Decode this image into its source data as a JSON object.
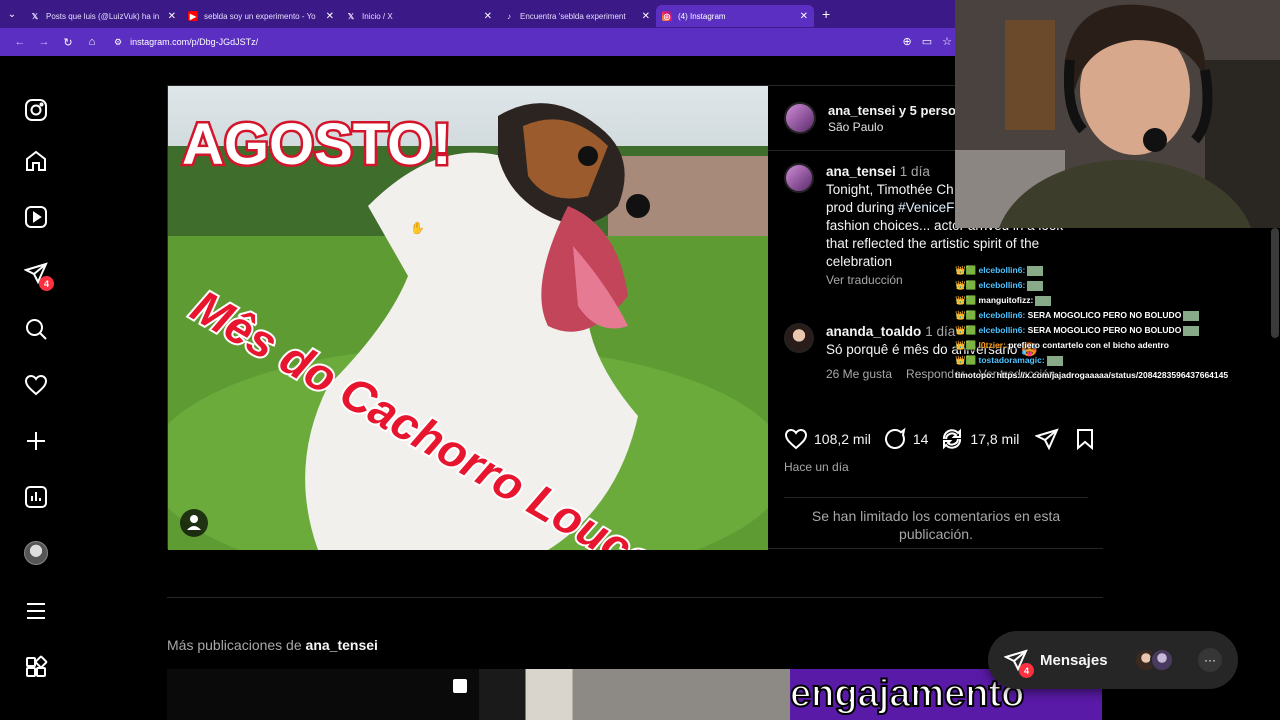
{
  "browser": {
    "tabs": [
      {
        "title": "Posts que luis (@LuizVuk) ha in",
        "icon": "x-logo"
      },
      {
        "title": "seblda soy un experimento - Yo",
        "icon": "youtube-logo"
      },
      {
        "title": "Inicio / X",
        "icon": "x-logo"
      },
      {
        "title": "Encuentra 'seblda experiment",
        "icon": "tiktok-logo"
      },
      {
        "title": "(4) Instagram",
        "icon": "instagram-logo",
        "active": true
      }
    ],
    "url": "instagram.com/p/Dbg-JGdJSTz/"
  },
  "sidebar": {
    "messages_badge": "4"
  },
  "post": {
    "image_text_top": "AGOSTO!",
    "image_text_bottom": "Mês do Cachorro Louco",
    "header_name": "ana_tensei y 5 perso",
    "header_location": "São Paulo",
    "caption": {
      "user": "ana_tensei",
      "time": "1 día",
      "text_before": "Tonight, Timothée Ch among directors, prod during",
      "hashtag": "#VeniceFilmFe",
      "text_after": "to standout fashion choices... actor arrived in a look that reflected the artistic spirit of the celebration",
      "translate": "Ver traducción"
    },
    "comment": {
      "user": "ananda_toaldo",
      "time": "1 día",
      "text": "Só porquê é mês do aniversário 🥵",
      "likes": "26 Me gusta",
      "reply": "Responder",
      "translate": "Ver traducción"
    },
    "likes": "108,2 mil",
    "comments": "14",
    "reposts": "17,8 mil",
    "timestamp": "Hace un día",
    "limited_notice": "Se han limitado los comentarios en esta publicación."
  },
  "more_posts": {
    "prefix": "Más publicaciones de",
    "user": "ana_tensei",
    "thumb3_text": "engajamento"
  },
  "messages_widget": {
    "label": "Mensajes",
    "badge": "4",
    "more": "···"
  },
  "stream_chat": [
    {
      "user": "elcebollin6:",
      "msg": "",
      "color": "blue"
    },
    {
      "user": "elcebollin6:",
      "msg": "",
      "color": "blue"
    },
    {
      "user": "manguitofizz:",
      "msg": "",
      "color": "white"
    },
    {
      "user": "elcebollin6:",
      "msg": "SERA MOGOLICO PERO NO BOLUDO",
      "color": "blue"
    },
    {
      "user": "elcebollin6:",
      "msg": "SERA MOGOLICO PERO NO BOLUDO",
      "color": "blue"
    },
    {
      "user": "l0tzier:",
      "msg": "prefiero contartelo con el bicho adentro",
      "color": "orange"
    },
    {
      "user": "tostadoramagic:",
      "msg": "",
      "color": "blue"
    },
    {
      "user": "timotopo:",
      "msg": "https://x.com/jajadrogaaaaa/status/2084283596437664145",
      "color": "white"
    }
  ]
}
